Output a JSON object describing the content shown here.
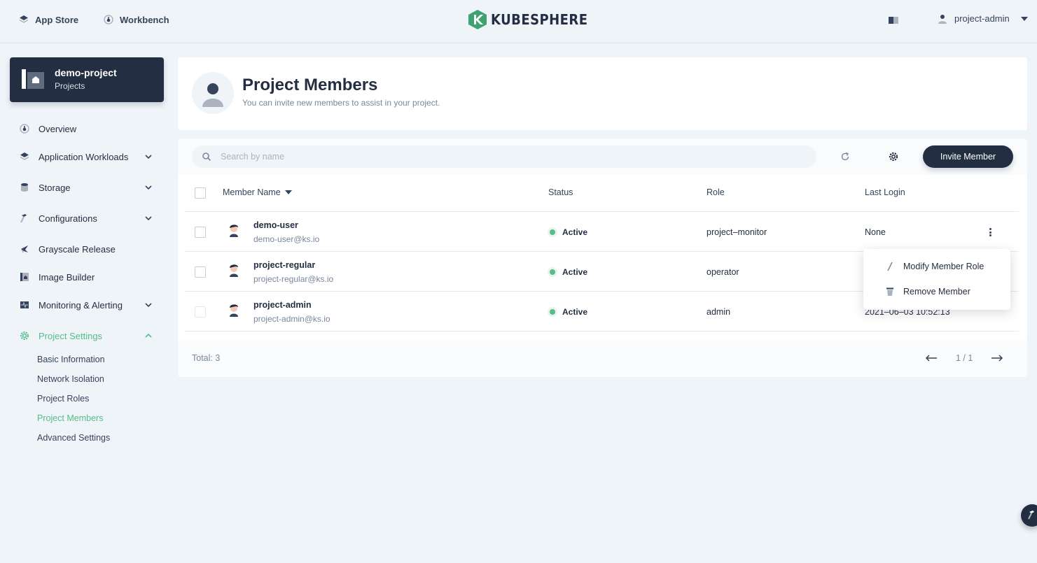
{
  "topnav": {
    "app_store": "App Store",
    "workbench": "Workbench",
    "logo_text": "KUBESPHERE",
    "user": "project-admin"
  },
  "project": {
    "name": "demo-project",
    "type": "Projects"
  },
  "sidebar": {
    "items": [
      {
        "label": "Overview",
        "icon": "dashboard-icon"
      },
      {
        "label": "Application Workloads",
        "icon": "layers-icon"
      },
      {
        "label": "Storage",
        "icon": "database-icon"
      },
      {
        "label": "Configurations",
        "icon": "hammer-icon"
      },
      {
        "label": "Grayscale Release",
        "icon": "bird-icon"
      },
      {
        "label": "Image Builder",
        "icon": "image-builder-icon"
      },
      {
        "label": "Monitoring & Alerting",
        "icon": "monitor-icon"
      },
      {
        "label": "Project Settings",
        "icon": "gear-icon"
      }
    ],
    "settings_sub": [
      "Basic Information",
      "Network Isolation",
      "Project Roles",
      "Project Members",
      "Advanced Settings"
    ]
  },
  "header": {
    "title": "Project Members",
    "description": "You can invite new members to assist in your project."
  },
  "toolbar": {
    "search_placeholder": "Search by name",
    "invite_label": "Invite Member"
  },
  "table": {
    "columns": [
      "Member Name",
      "Status",
      "Role",
      "Last Login"
    ],
    "rows": [
      {
        "name": "demo-user",
        "email": "demo-user@ks.io",
        "status": "Active",
        "role": "project–monitor",
        "last_login": "None"
      },
      {
        "name": "project-regular",
        "email": "project-regular@ks.io",
        "status": "Active",
        "role": "operator",
        "last_login": ""
      },
      {
        "name": "project-admin",
        "email": "project-admin@ks.io",
        "status": "Active",
        "role": "admin",
        "last_login": "2021–06–03 10:52:13"
      }
    ],
    "total": "Total: 3",
    "page": "1 / 1"
  },
  "dropdown": {
    "modify": "Modify Member Role",
    "remove": "Remove Member"
  },
  "colors": {
    "accent": "#55bc8a",
    "dark": "#242e42",
    "background": "#eff4f9"
  }
}
